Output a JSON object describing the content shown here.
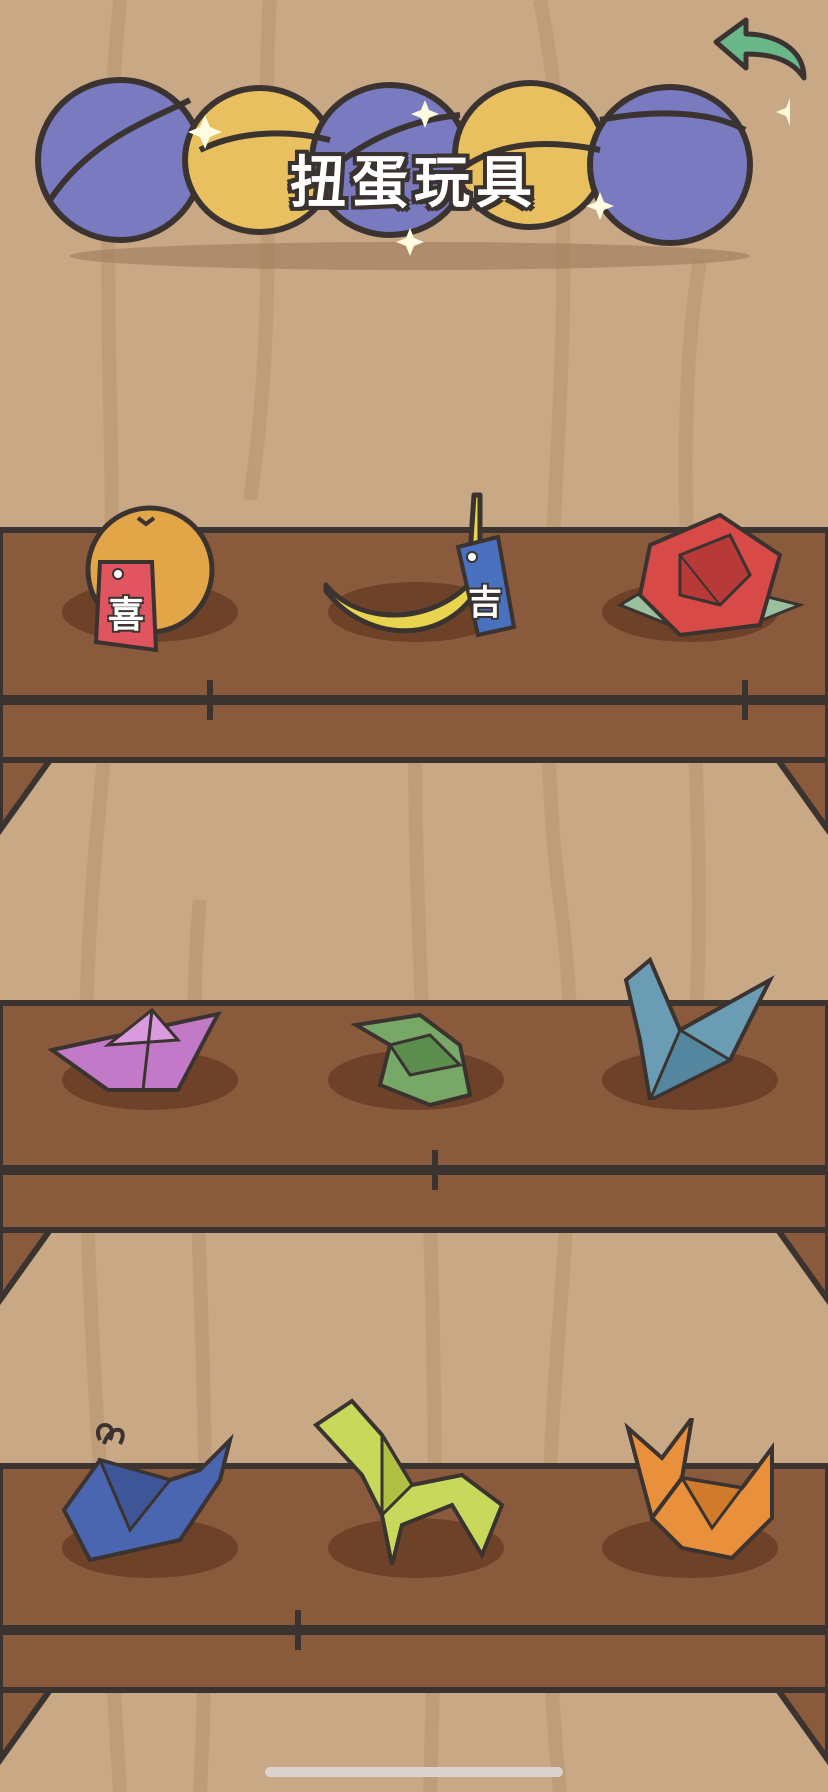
{
  "title": "扭蛋玩具",
  "back_button_icon": "back-arrow-icon",
  "capsule_colors": [
    "#7a7ac0",
    "#e8c060",
    "#7a7ac0",
    "#e8c060",
    "#7a7ac0"
  ],
  "shelves": [
    {
      "items": [
        {
          "name": "orange",
          "tag": "喜",
          "tag_color": "#e05560"
        },
        {
          "name": "banana",
          "tag": "吉",
          "tag_color": "#4a70c0"
        },
        {
          "name": "origami-rose"
        }
      ]
    },
    {
      "items": [
        {
          "name": "origami-boat"
        },
        {
          "name": "origami-frog"
        },
        {
          "name": "origami-crane"
        }
      ]
    },
    {
      "items": [
        {
          "name": "origami-whale"
        },
        {
          "name": "origami-horse"
        },
        {
          "name": "origami-fox"
        }
      ]
    }
  ],
  "colors": {
    "wall": "#c9a886",
    "shelf": "#8a5a3c",
    "outline": "#3a3330",
    "back_arrow": "#6ab88a"
  }
}
